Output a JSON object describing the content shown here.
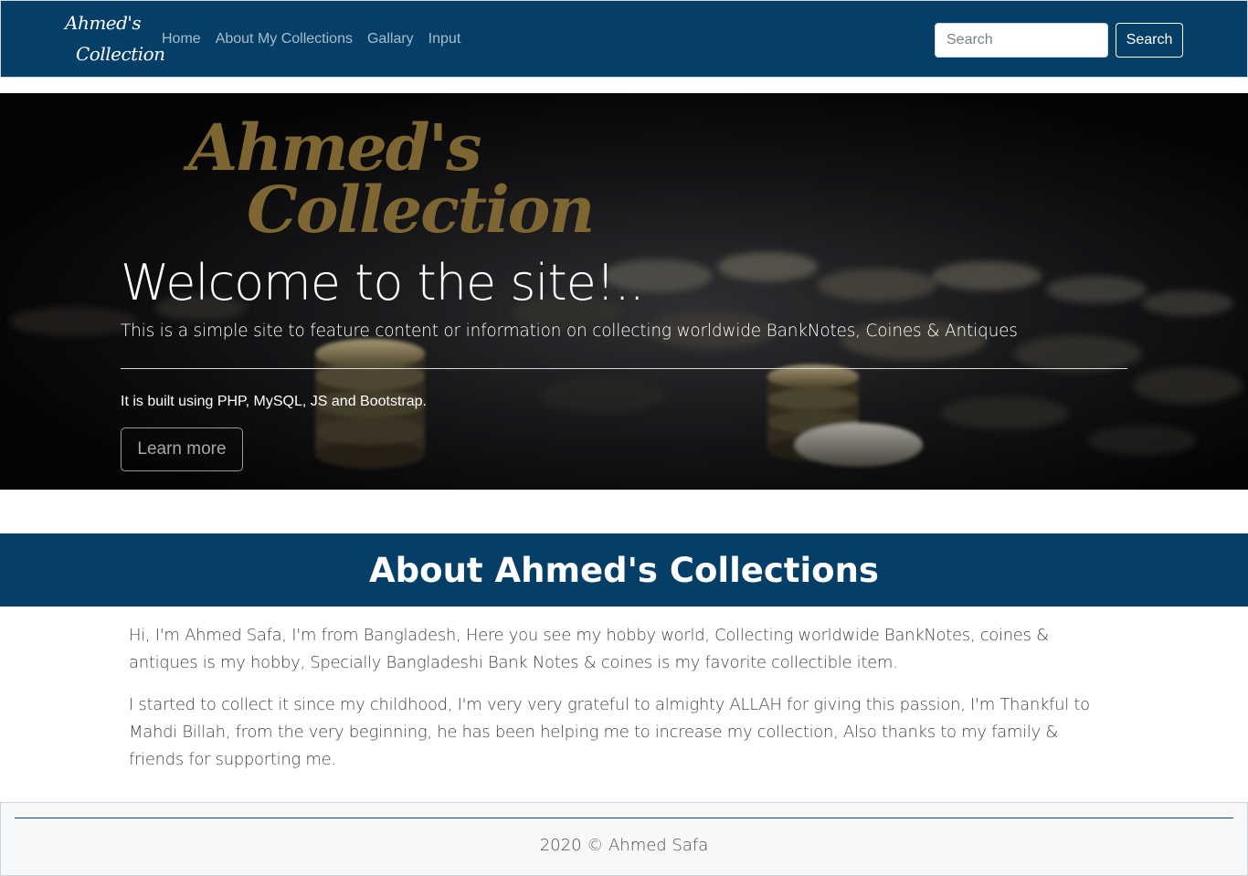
{
  "navbar": {
    "brand_line1": "Ahmed's",
    "brand_line2": "Collection",
    "links": [
      "Home",
      "About My Collections",
      "Gallary",
      "Input"
    ],
    "search_placeholder": "Search",
    "search_button": "Search",
    "background_color": "#053f68"
  },
  "hero": {
    "logo_line1": "Ahmed's",
    "logo_line2": "Collection",
    "title": "Welcome to the site!..",
    "lead": "This is a simple site to feature content or information on collecting worldwide BankNotes, Coines & Antiques",
    "built_with": "It is built using PHP, MySQL, JS and Bootstrap.",
    "button": "Learn more"
  },
  "about": {
    "title": "About Ahmed's Collections",
    "paragraphs": [
      "Hi, I'm Ahmed Safa, I'm from Bangladesh, Here you see my hobby world, Collecting worldwide BankNotes, coines & antiques is my hobby, Specially Bangladeshi Bank Notes & coines is my favorite collectible item.",
      "I started to collect it since my childhood, I'm very very grateful to almighty ALLAH for giving this passion, I'm Thankful to Mahdi Billah, from the very beginning, he has been helping me to increase my collection, Also thanks to my family & friends for supporting me."
    ]
  },
  "footer": {
    "text": "2020 © Ahmed Safa"
  }
}
